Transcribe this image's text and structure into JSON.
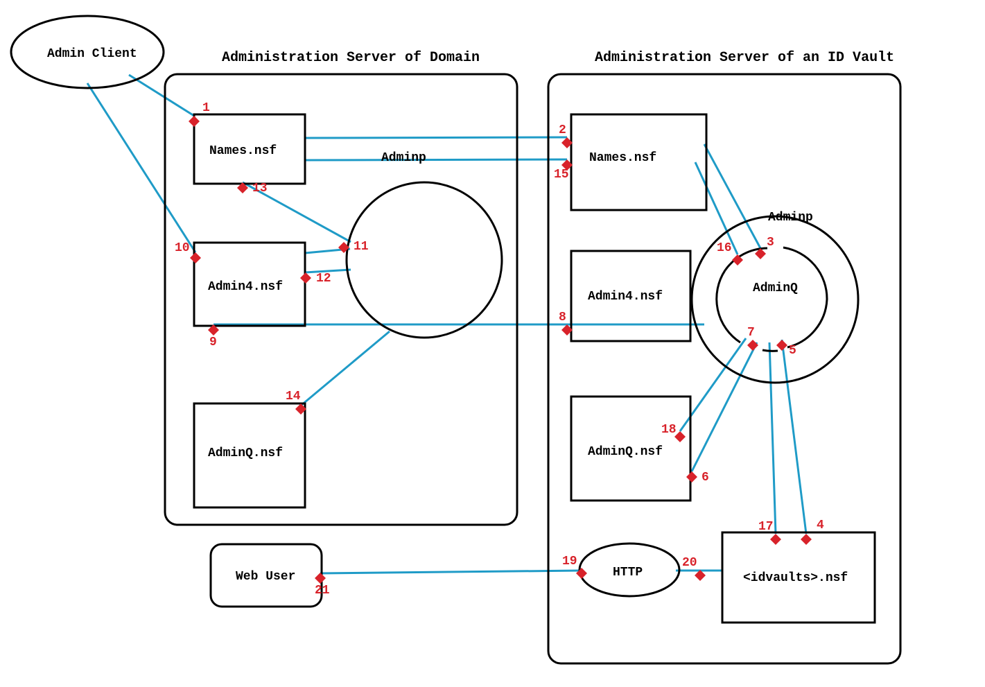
{
  "titles": {
    "domain": "Administration Server of Domain",
    "vault": "Administration Server of an ID Vault"
  },
  "nodes": {
    "adminClient": "Admin Client",
    "webUser": "Web User",
    "http": "HTTP",
    "adminpDomain": "Adminp",
    "adminpVault": "Adminp",
    "adminQ": "AdminQ",
    "namesDomain": "Names.nsf",
    "admin4Domain": "Admin4.nsf",
    "adminQDomain": "AdminQ.nsf",
    "namesVault": "Names.nsf",
    "admin4Vault": "Admin4.nsf",
    "adminQVault": "AdminQ.nsf",
    "idvaults": "<idvaults>.nsf"
  },
  "points": {
    "p1": "1",
    "p2": "2",
    "p3": "3",
    "p4": "4",
    "p5": "5",
    "p6": "6",
    "p7": "7",
    "p8": "8",
    "p9": "9",
    "p10": "10",
    "p11": "11",
    "p12": "12",
    "p13": "13",
    "p14": "14",
    "p15": "15",
    "p16": "16",
    "p17": "17",
    "p18": "18",
    "p19": "19",
    "p20": "20",
    "p21": "21"
  }
}
